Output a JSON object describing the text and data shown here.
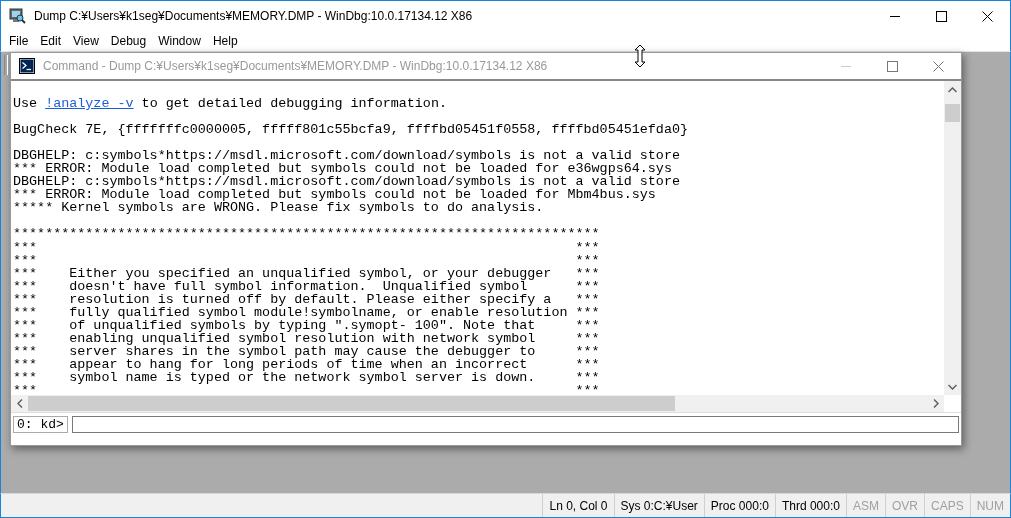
{
  "window": {
    "title": "Dump C:¥Users¥k1seg¥Documents¥MEMORY.DMP - WinDbg:10.0.17134.12 X86"
  },
  "menu": [
    "File",
    "Edit",
    "View",
    "Debug",
    "Window",
    "Help"
  ],
  "command_window": {
    "title": "Command - Dump C:¥Users¥k1seg¥Documents¥MEMORY.DMP - WinDbg:10.0.17134.12 X86",
    "active": false,
    "output": [
      {
        "kind": "hint",
        "before": "Use ",
        "link": "!analyze -v",
        "after": " to get detailed debugging information."
      },
      {
        "kind": "blank"
      },
      {
        "kind": "text",
        "text": "BugCheck 7E, {fffffffc0000005, fffff801c55bcfa9, ffffbd05451f0558, ffffbd05451efda0}"
      },
      {
        "kind": "blank"
      },
      {
        "kind": "text",
        "text": "DBGHELP: c:symbols*https://msdl.microsoft.com/download/symbols is not a valid store"
      },
      {
        "kind": "text",
        "text": "*** ERROR: Module load completed but symbols could not be loaded for e36wgps64.sys"
      },
      {
        "kind": "text",
        "text": "DBGHELP: c:symbols*https://msdl.microsoft.com/download/symbols is not a valid store"
      },
      {
        "kind": "text",
        "text": "*** ERROR: Module load completed but symbols could not be loaded for Mbm4bus.sys"
      },
      {
        "kind": "text",
        "text": "***** Kernel symbols are WRONG. Please fix symbols to do analysis."
      },
      {
        "kind": "blank"
      },
      {
        "kind": "text",
        "text": "*************************************************************************"
      },
      {
        "kind": "boxed",
        "left": "***",
        "right": "***"
      },
      {
        "kind": "boxed",
        "left": "***",
        "right": "***"
      },
      {
        "kind": "boxed",
        "left": "***",
        "text": "Either you specified an unqualified symbol, or your debugger",
        "right": "***"
      },
      {
        "kind": "boxed",
        "left": "***",
        "text": "doesn't have full symbol information.  Unqualified symbol",
        "right": "***"
      },
      {
        "kind": "boxed",
        "left": "***",
        "text": "resolution is turned off by default. Please either specify a",
        "right": "***"
      },
      {
        "kind": "boxed",
        "left": "***",
        "text": "fully qualified symbol module!symbolname, or enable resolution",
        "right": "***"
      },
      {
        "kind": "boxed",
        "left": "***",
        "text": "of unqualified symbols by typing \".symopt- 100\". Note that",
        "right": "***"
      },
      {
        "kind": "boxed",
        "left": "***",
        "text": "enabling unqualified symbol resolution with network symbol",
        "right": "***"
      },
      {
        "kind": "boxed",
        "left": "***",
        "text": "server shares in the symbol path may cause the debugger to",
        "right": "***"
      },
      {
        "kind": "boxed",
        "left": "***",
        "text": "appear to hang for long periods of time when an incorrect",
        "right": "***"
      },
      {
        "kind": "boxed",
        "left": "***",
        "text": "symbol name is typed or the network symbol server is down.",
        "right": "***"
      },
      {
        "kind": "boxed",
        "left": "***",
        "right": "***"
      }
    ],
    "prompt": "0: kd>"
  },
  "status_bar": [
    {
      "text": "Ln 0, Col 0",
      "enabled": true
    },
    {
      "text": "Sys 0:C:¥User",
      "enabled": true
    },
    {
      "text": "Proc 000:0",
      "enabled": true
    },
    {
      "text": "Thrd 000:0",
      "enabled": true
    },
    {
      "text": "ASM",
      "enabled": false
    },
    {
      "text": "OVR",
      "enabled": false
    },
    {
      "text": "CAPS",
      "enabled": false
    },
    {
      "text": "NUM",
      "enabled": false
    }
  ]
}
